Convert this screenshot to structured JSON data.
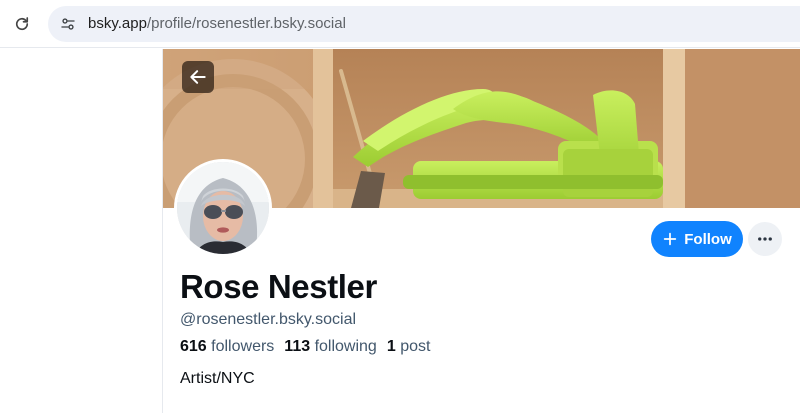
{
  "browser": {
    "url_host": "bsky.app",
    "url_path": "/profile/rosenestler.bsky.social",
    "reload_icon": "reload-icon",
    "site_info_icon": "tune-icon"
  },
  "profile": {
    "display_name": "Rose Nestler",
    "handle": "@rosenestler.bsky.social",
    "followers_count": "616",
    "followers_label": "followers",
    "following_count": "113",
    "following_label": "following",
    "posts_count": "1",
    "posts_label": "post",
    "bio": "Artist/NYC"
  },
  "actions": {
    "follow_label": "Follow",
    "follow_icon": "plus-icon",
    "more_icon": "ellipsis-icon",
    "back_icon": "arrow-left-icon"
  },
  "colors": {
    "accent": "#1083fe",
    "muted_text": "#42576c",
    "banner_object": "#b6e24a"
  }
}
